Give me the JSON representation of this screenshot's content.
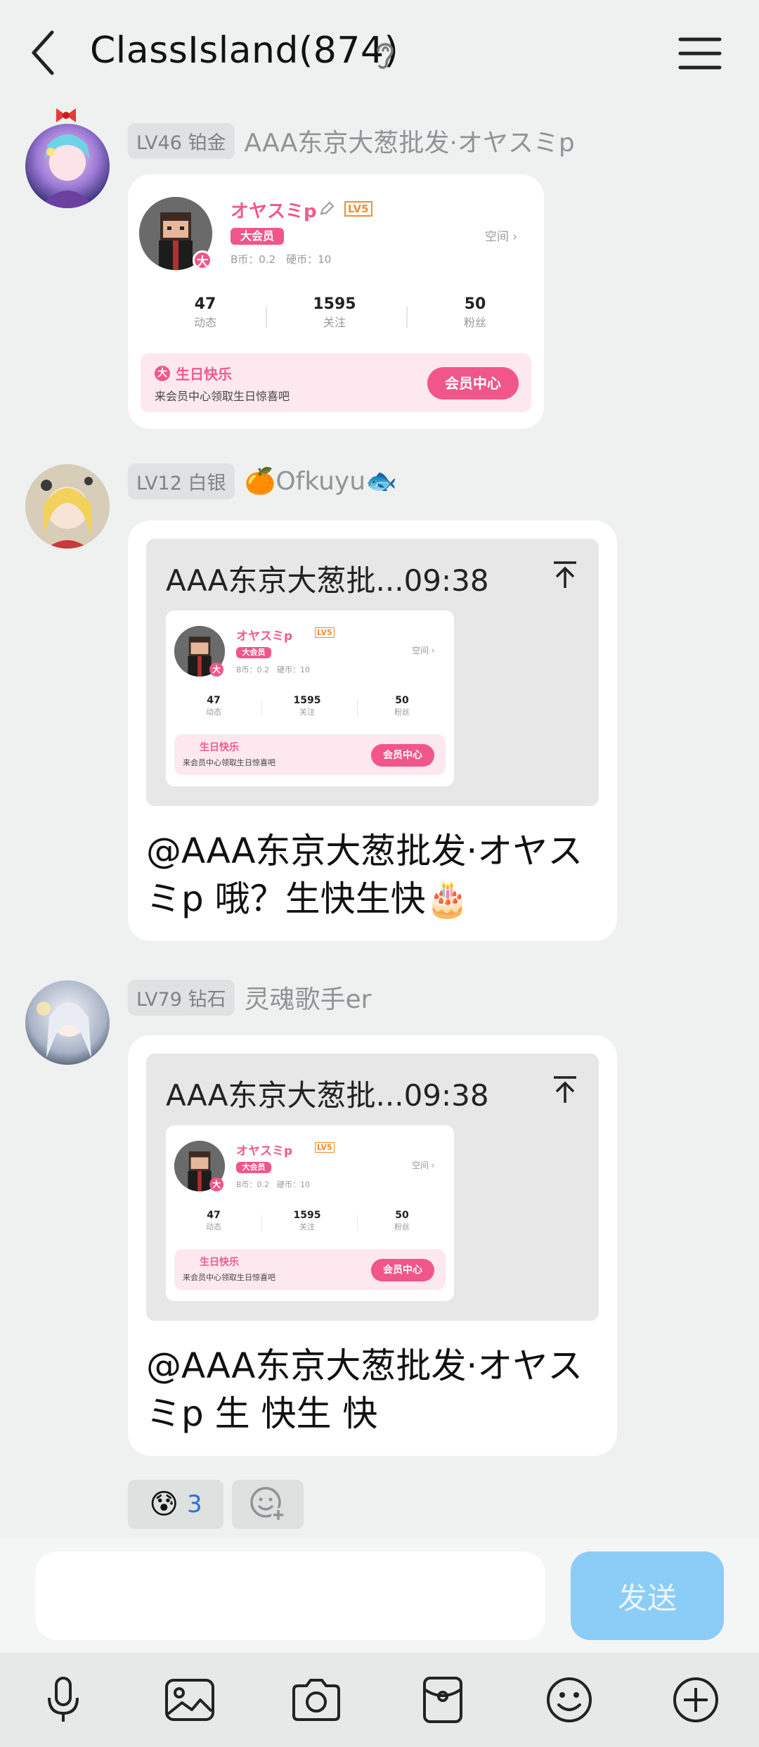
{
  "header": {
    "title": "ClassIsland(874)"
  },
  "messages": [
    {
      "level": "LV46 铂金",
      "nickname": "AAA东京大葱批发·オヤスミp",
      "card": {
        "name": "オヤスミp",
        "lv": "LV5",
        "vip": "大会员",
        "coins": "B币：0.2　硬币：10",
        "space": "空间",
        "stats": [
          {
            "num": "47",
            "label": "动态"
          },
          {
            "num": "1595",
            "label": "关注"
          },
          {
            "num": "50",
            "label": "粉丝"
          }
        ],
        "bday_title": "生日快乐",
        "bday_sub": "来会员中心领取生日惊喜吧",
        "bday_btn": "会员中心",
        "dot": "大"
      }
    },
    {
      "level": "LV12 白银",
      "nickname": "🍊Ofkuyu🐟",
      "reply_head": "AAA东京大葱批...09:38",
      "text_line1": "@AAA东京大葱批发·オヤス",
      "text_line2": "ミp 哦？生快生快🎂"
    },
    {
      "level": "LV79 钻石",
      "nickname": "灵魂歌手er",
      "reply_head": "AAA东京大葱批...09:38",
      "text_line1": "@AAA东京大葱批发·オヤス",
      "text_line2": "ミp 生 快生 快"
    }
  ],
  "reactions": [
    {
      "emoji": "😰",
      "count": "3"
    }
  ],
  "input": {
    "placeholder": "",
    "send_label": "发送"
  },
  "toolbar": [
    "mic-icon",
    "image-icon",
    "camera-icon",
    "red-packet-icon",
    "emoji-icon",
    "plus-icon"
  ]
}
